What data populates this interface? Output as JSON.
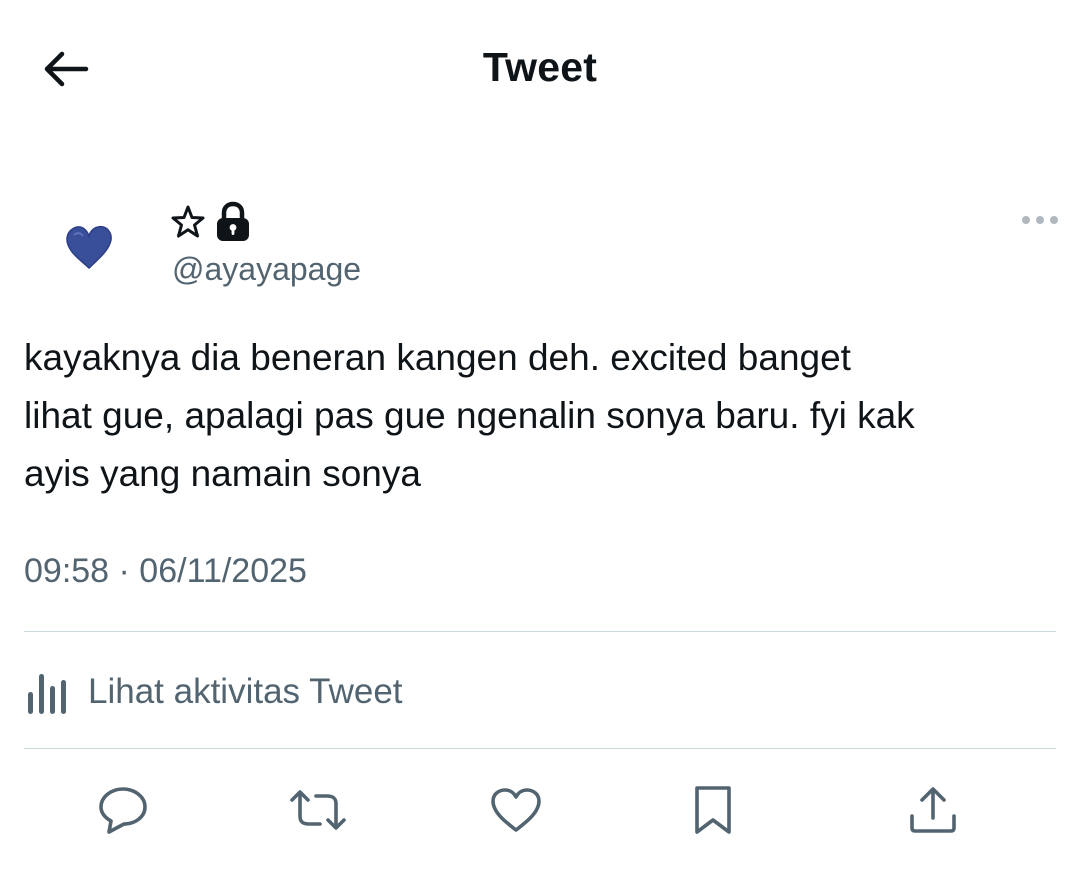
{
  "header": {
    "title": "Tweet",
    "back_icon": "arrow-left-icon"
  },
  "author": {
    "avatar_icon": "blue-heart-avatar",
    "name_icons": [
      "star-outline-icon",
      "lock-icon"
    ],
    "handle": "@ayayapage",
    "more_icon": "more-horizontal-icon"
  },
  "tweet": {
    "text": "kayaknya dia beneran kangen deh. excited banget\nlihat gue, apalagi pas gue ngenalin sonya baru. fyi kak\nayis yang namain sonya",
    "timestamp": "09:58 · 06/11/2025"
  },
  "activity": {
    "label": "Lihat aktivitas Tweet",
    "icon": "bar-chart-icon"
  },
  "actions": [
    {
      "name": "reply-icon"
    },
    {
      "name": "retweet-icon"
    },
    {
      "name": "like-icon"
    },
    {
      "name": "bookmark-icon"
    },
    {
      "name": "share-icon"
    }
  ],
  "colors": {
    "text_primary": "#0f1419",
    "text_secondary": "#536471",
    "divider": "#cfd9de",
    "avatar_heart": "#3a4f9a"
  }
}
